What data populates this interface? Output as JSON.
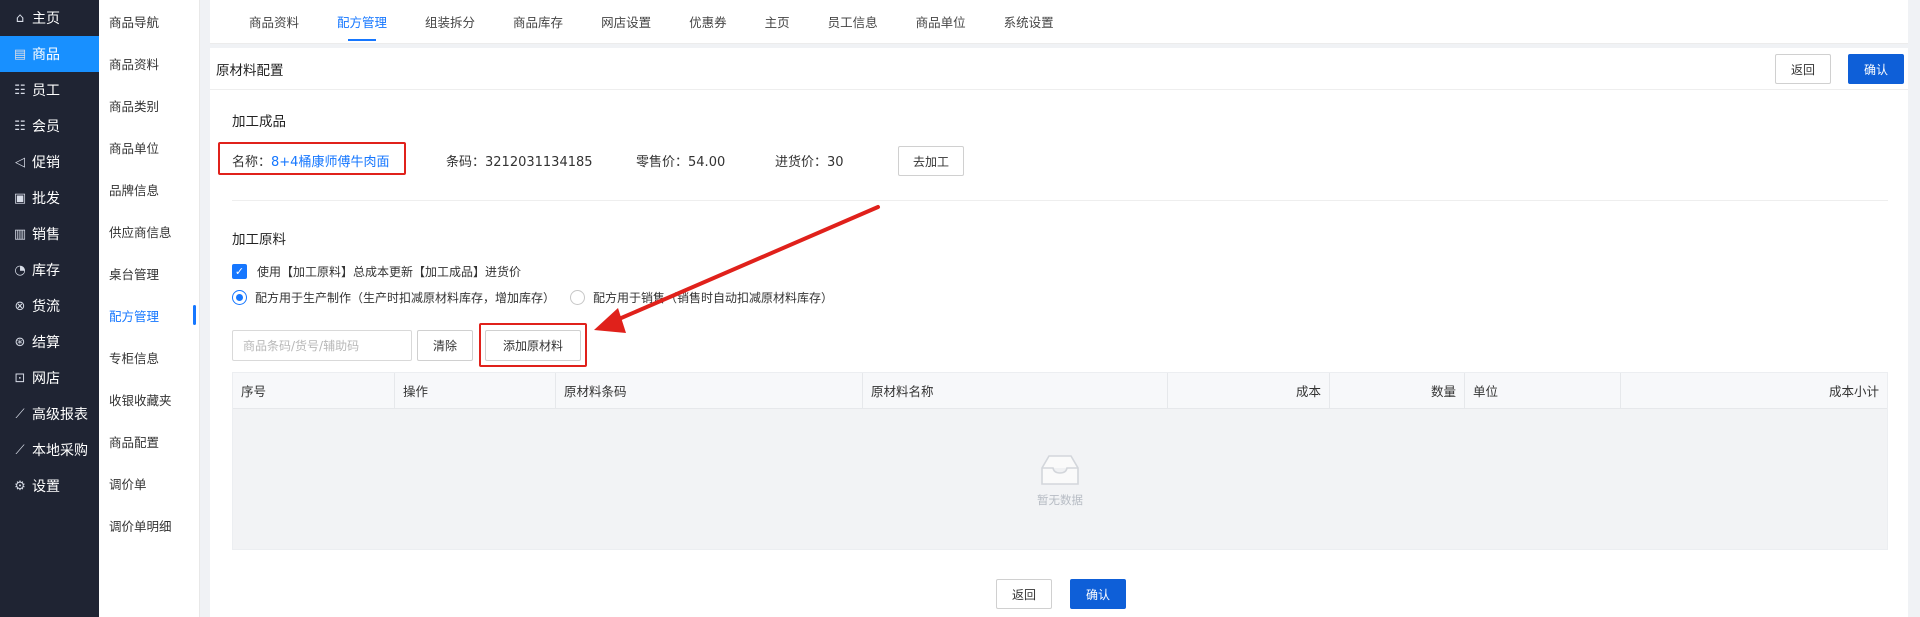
{
  "sidebar": {
    "items": [
      {
        "label": "主页",
        "icon": "home-icon",
        "glyph": "⌂"
      },
      {
        "label": "商品",
        "icon": "goods-icon",
        "glyph": "▤",
        "active": true
      },
      {
        "label": "员工",
        "icon": "staff-icon",
        "glyph": "☷"
      },
      {
        "label": "会员",
        "icon": "member-icon",
        "glyph": "☷"
      },
      {
        "label": "促销",
        "icon": "promo-icon",
        "glyph": "◁"
      },
      {
        "label": "批发",
        "icon": "wholesale-icon",
        "glyph": "▣"
      },
      {
        "label": "销售",
        "icon": "sales-icon",
        "glyph": "▥"
      },
      {
        "label": "库存",
        "icon": "inventory-icon",
        "glyph": "◔"
      },
      {
        "label": "货流",
        "icon": "flow-icon",
        "glyph": "⊗"
      },
      {
        "label": "结算",
        "icon": "settle-icon",
        "glyph": "⊛"
      },
      {
        "label": "网店",
        "icon": "shop-icon",
        "glyph": "⊡"
      },
      {
        "label": "高级报表",
        "icon": "report-icon",
        "glyph": "⟋"
      },
      {
        "label": "本地采购",
        "icon": "purchase-icon",
        "glyph": "⟋"
      },
      {
        "label": "设置",
        "icon": "gear-icon",
        "glyph": "⚙"
      }
    ]
  },
  "subnav": {
    "items": [
      "商品导航",
      "商品资料",
      "商品类别",
      "商品单位",
      "品牌信息",
      "供应商信息",
      "桌台管理",
      "配方管理",
      "专柜信息",
      "收银收藏夹",
      "商品配置",
      "调价单",
      "调价单明细"
    ],
    "active_index": 7
  },
  "tabs": {
    "items": [
      "商品资料",
      "配方管理",
      "组装拆分",
      "商品库存",
      "网店设置",
      "优惠券",
      "主页",
      "员工信息",
      "商品单位",
      "系统设置"
    ],
    "active_index": 1
  },
  "panel": {
    "title": "原材料配置",
    "back_label": "返回",
    "confirm_label": "确认"
  },
  "product": {
    "section_title": "加工成品",
    "name_label": "名称：",
    "name_value": "8+4桶康师傅牛肉面",
    "barcode_label": "条码：",
    "barcode_value": "3212031134185",
    "retail_label": "零售价：",
    "retail_value": "54.00",
    "purchase_label": "进货价：",
    "purchase_value": "30",
    "process_button": "去加工"
  },
  "materials": {
    "section_title": "加工原料",
    "checkbox_label": "使用【加工原料】总成本更新【加工成品】进货价",
    "radio1_label": "配方用于生产制作（生产时扣减原材料库存，增加库存）",
    "radio2_label": "配方用于销售（销售时自动扣减原材料库存）",
    "search_placeholder": "商品条码/货号/辅助码",
    "clear_button": "清除",
    "add_button": "添加原材料"
  },
  "table": {
    "columns": [
      "序号",
      "操作",
      "原材料条码",
      "原材料名称",
      "成本",
      "数量",
      "单位",
      "成本小计"
    ],
    "empty_text": "暂无数据"
  },
  "footer": {
    "back_label": "返回",
    "confirm_label": "确认"
  },
  "colors": {
    "sidebar_bg": "#1f2433",
    "accent": "#1677ff",
    "primary_button": "#0e5fd8",
    "annotation_red": "#e0211b"
  }
}
